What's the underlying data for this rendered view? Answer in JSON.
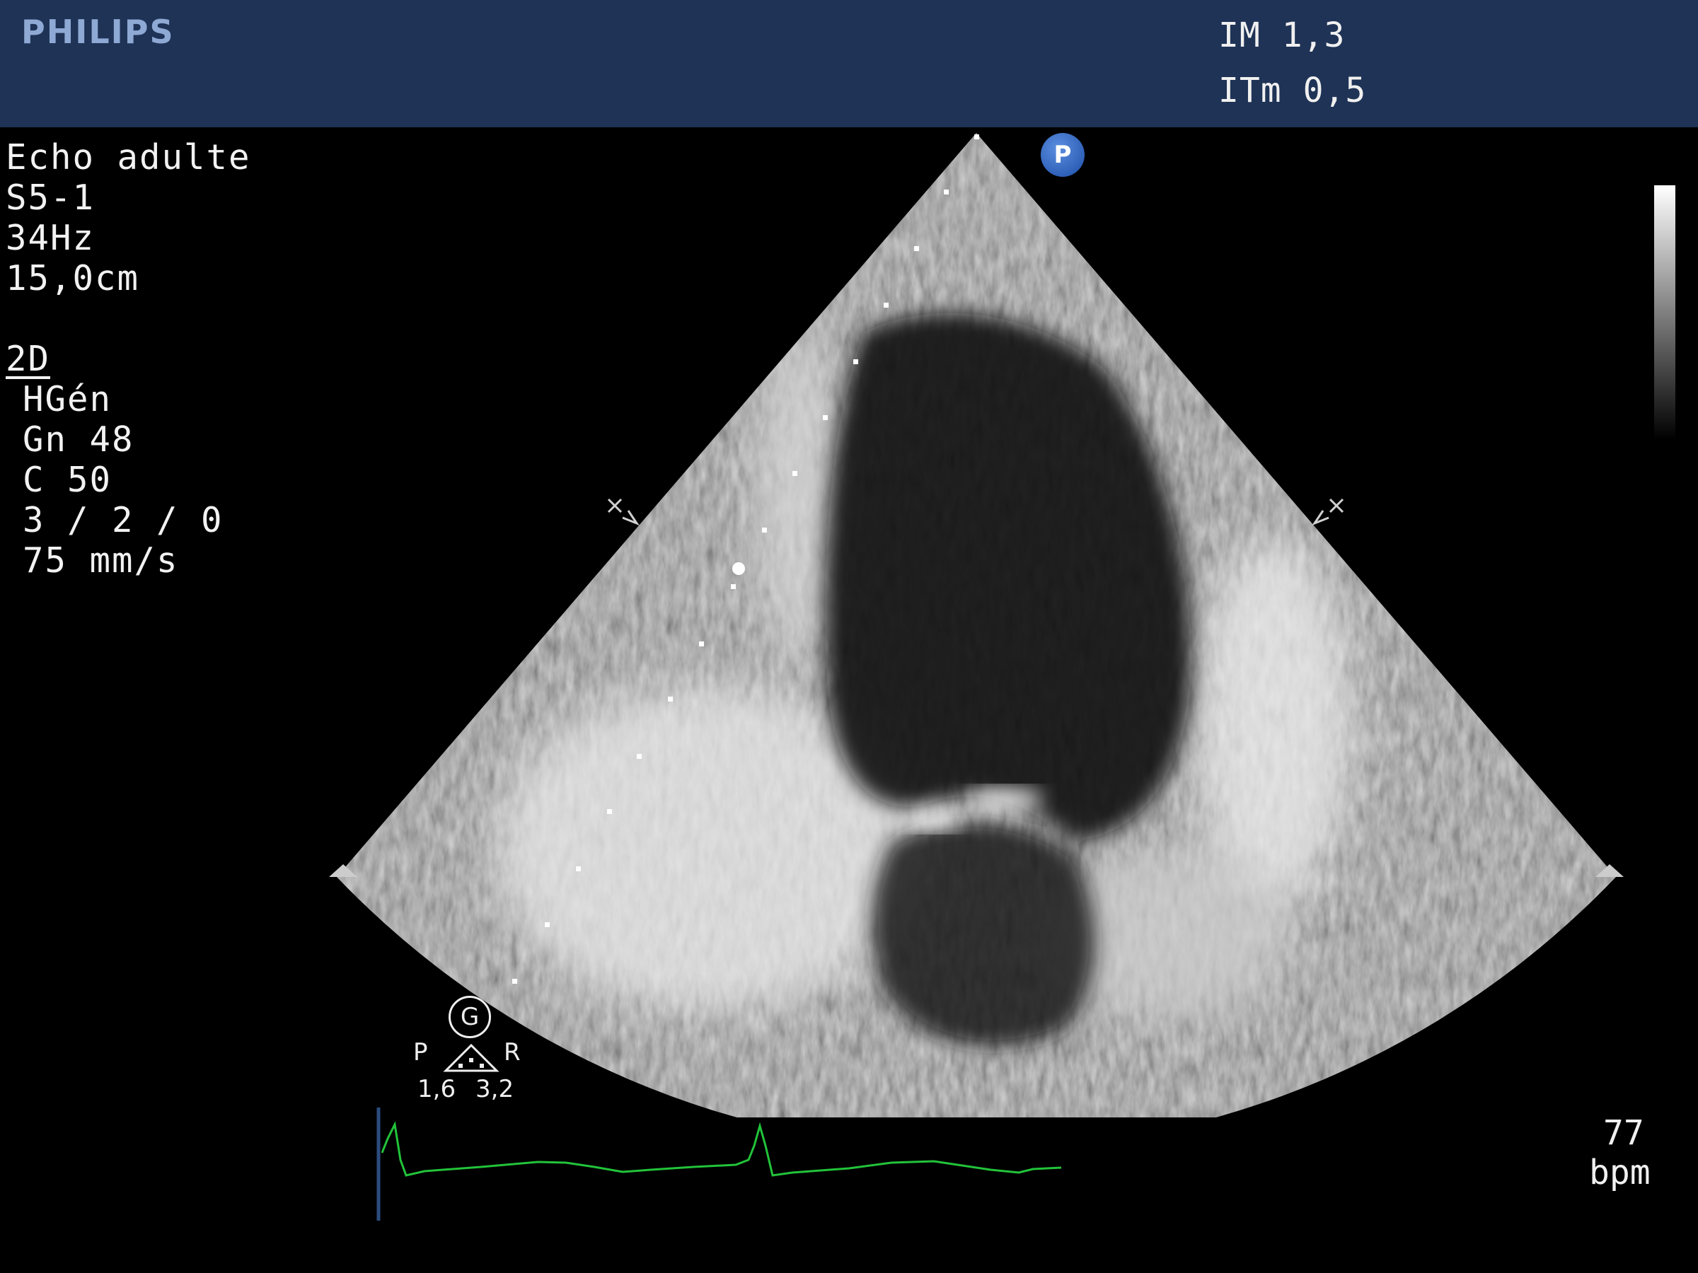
{
  "header": {
    "brand": "PHILIPS",
    "mi": "IM 1,3",
    "tis": "ITm 0,5"
  },
  "left_panel": {
    "preset": "Echo adulte",
    "probe": "S5-1",
    "frame_rate": "34Hz",
    "depth": "15,0cm",
    "mode": "2D",
    "mode_settings": [
      "HGén",
      "Gn 48",
      "C 50",
      "3 / 2 / 0",
      "75 mm/s"
    ]
  },
  "probe_marker": "P",
  "gain_indicator": {
    "g": "G",
    "p": "P",
    "r": "R",
    "value_left": "1,6",
    "value_right": "3,2"
  },
  "heart_rate": {
    "value": "77",
    "unit": "bpm"
  },
  "colors": {
    "header_bg": "#1f3356",
    "ecg_trace": "#22c33a",
    "probe_badge": "#2d5fc0"
  }
}
